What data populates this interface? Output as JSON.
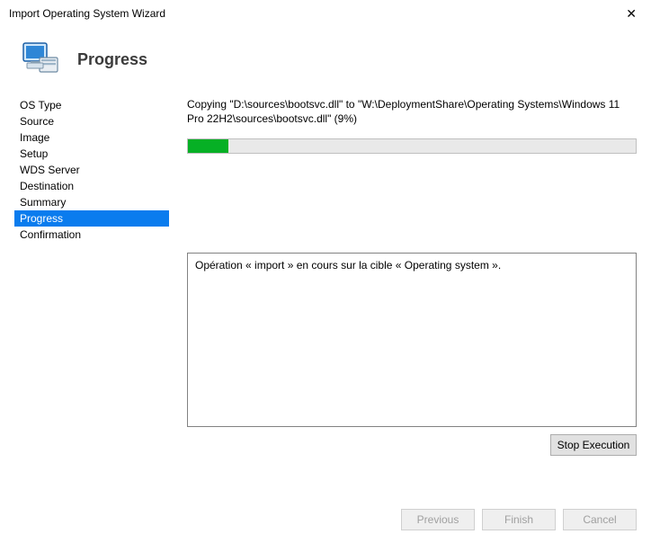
{
  "window": {
    "title": "Import Operating System Wizard",
    "close_glyph": "✕"
  },
  "header": {
    "heading": "Progress"
  },
  "sidebar": {
    "items": [
      {
        "label": "OS Type"
      },
      {
        "label": "Source"
      },
      {
        "label": "Image"
      },
      {
        "label": "Setup"
      },
      {
        "label": "WDS Server"
      },
      {
        "label": "Destination"
      },
      {
        "label": "Summary"
      },
      {
        "label": "Progress"
      },
      {
        "label": "Confirmation"
      }
    ],
    "selected_index": 7
  },
  "progress": {
    "status_text": "Copying \"D:\\sources\\bootsvc.dll\" to \"W:\\DeploymentShare\\Operating Systems\\Windows 11 Pro 22H2\\sources\\bootsvc.dll\" (9%)",
    "percent": 9,
    "log_lines": [
      "Opération « import » en cours sur la cible « Operating system »."
    ],
    "stop_label": "Stop Execution"
  },
  "footer": {
    "previous_label": "Previous",
    "finish_label": "Finish",
    "cancel_label": "Cancel"
  }
}
